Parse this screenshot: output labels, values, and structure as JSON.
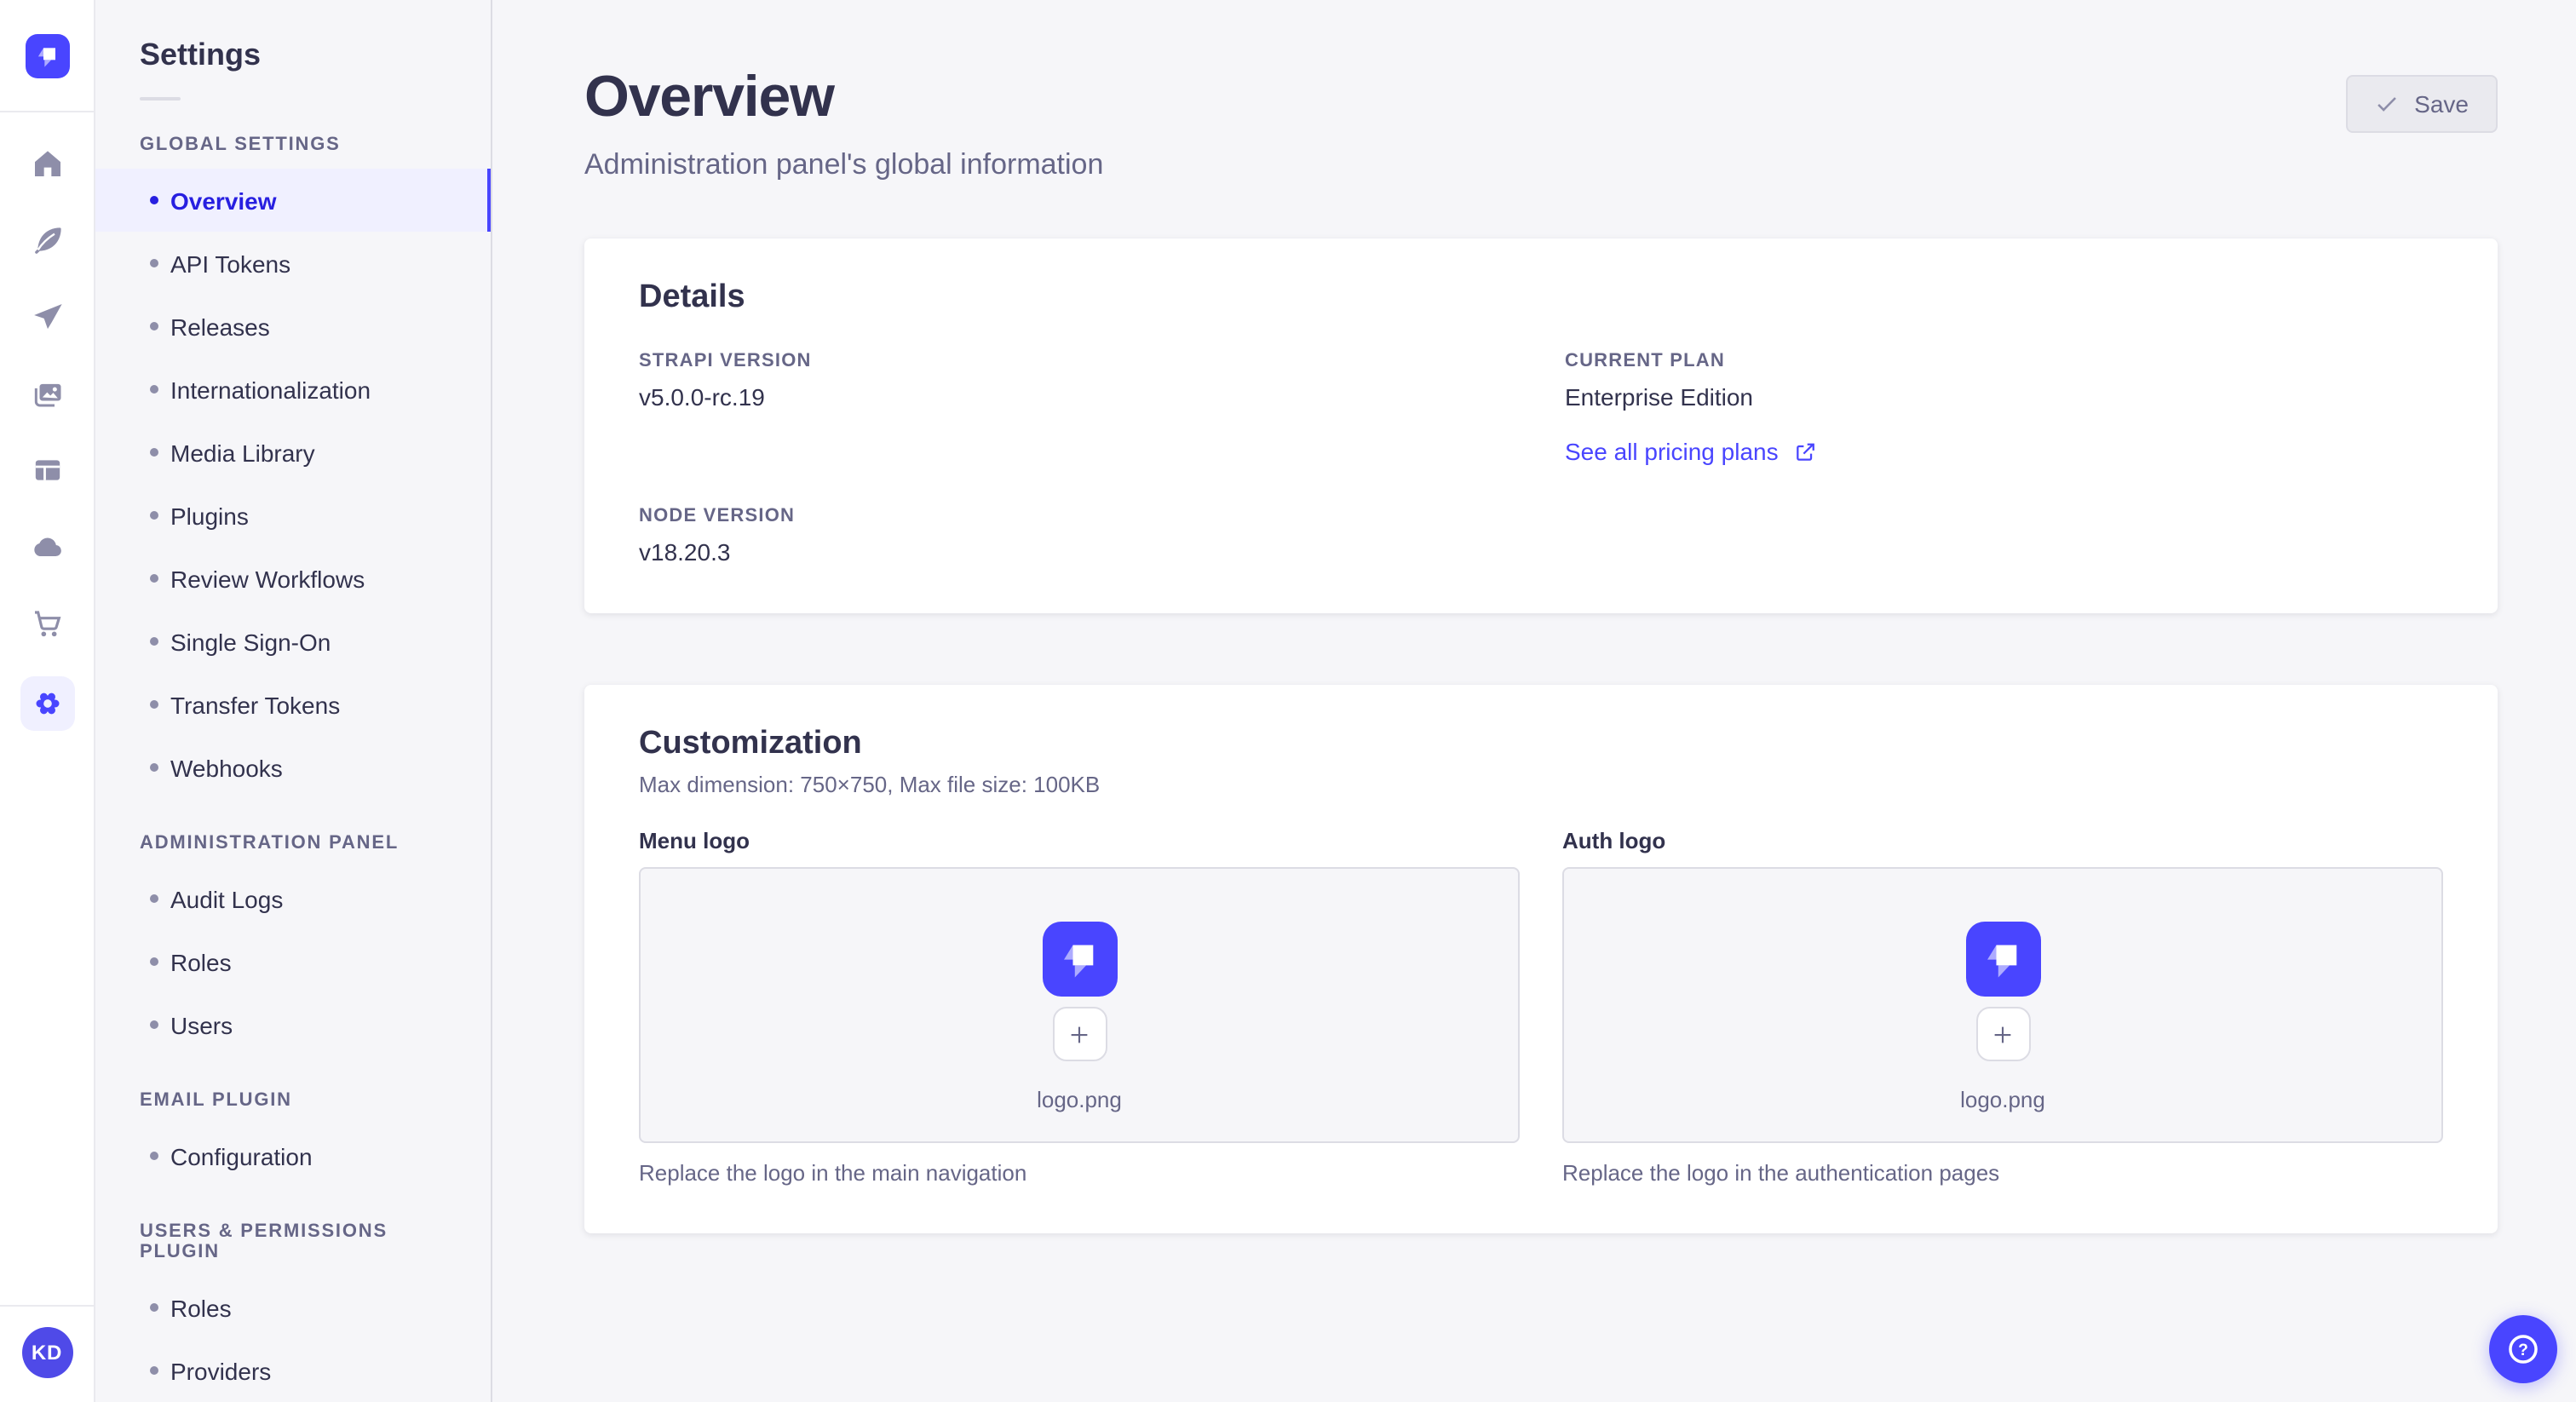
{
  "colors": {
    "primary": "#4945ff",
    "active_bg": "#f0f0ff",
    "active_text": "#271fe0",
    "page_bg": "#f6f6f9"
  },
  "rail": {
    "avatar_initials": "KD",
    "icons": [
      "strapi-logo",
      "home",
      "feather",
      "paper-plane",
      "images",
      "layout",
      "cloud",
      "cart",
      "gear"
    ]
  },
  "sidebar": {
    "title": "Settings",
    "sections": [
      {
        "label": "GLOBAL SETTINGS",
        "items": [
          {
            "label": "Overview",
            "active": true
          },
          {
            "label": "API Tokens"
          },
          {
            "label": "Releases"
          },
          {
            "label": "Internationalization"
          },
          {
            "label": "Media Library"
          },
          {
            "label": "Plugins"
          },
          {
            "label": "Review Workflows"
          },
          {
            "label": "Single Sign-On"
          },
          {
            "label": "Transfer Tokens"
          },
          {
            "label": "Webhooks"
          }
        ]
      },
      {
        "label": "ADMINISTRATION PANEL",
        "items": [
          {
            "label": "Audit Logs"
          },
          {
            "label": "Roles"
          },
          {
            "label": "Users"
          }
        ]
      },
      {
        "label": "EMAIL PLUGIN",
        "items": [
          {
            "label": "Configuration"
          }
        ]
      },
      {
        "label": "USERS & PERMISSIONS PLUGIN",
        "items": [
          {
            "label": "Roles"
          },
          {
            "label": "Providers"
          }
        ]
      }
    ]
  },
  "header": {
    "title": "Overview",
    "subtitle": "Administration panel's global information",
    "save_label": "Save"
  },
  "details_card": {
    "heading": "Details",
    "strapi_version": {
      "label": "STRAPI VERSION",
      "value": "v5.0.0-rc.19"
    },
    "current_plan": {
      "label": "CURRENT PLAN",
      "value": "Enterprise Edition"
    },
    "pricing_link": "See all pricing plans",
    "node_version": {
      "label": "NODE VERSION",
      "value": "v18.20.3"
    }
  },
  "customization_card": {
    "heading": "Customization",
    "constraints": "Max dimension: 750×750, Max file size: 100KB",
    "menu_logo": {
      "label": "Menu logo",
      "filename": "logo.png",
      "hint": "Replace the logo in the main navigation"
    },
    "auth_logo": {
      "label": "Auth logo",
      "filename": "logo.png",
      "hint": "Replace the logo in the authentication pages"
    }
  }
}
